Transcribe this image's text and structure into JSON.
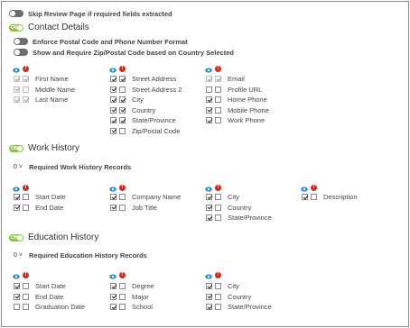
{
  "skip_review": {
    "label": "Skip Review Page if required fields extracted",
    "enabled": false
  },
  "contact": {
    "title": "Contact Details",
    "toggle_text": "ON",
    "options": [
      {
        "label": "Enforce Postal Code and Phone Number Format",
        "enabled": false
      },
      {
        "label": "Show and Require Zip/Postal Code based on Country Selected",
        "enabled": false
      }
    ],
    "columns": [
      {
        "fields": [
          {
            "label": "First Name",
            "visible": true,
            "required": true,
            "disabled": true
          },
          {
            "label": "Middle Name",
            "visible": true,
            "required": false,
            "disabled": true
          },
          {
            "label": "Last Name",
            "visible": true,
            "required": true,
            "disabled": true
          }
        ]
      },
      {
        "fields": [
          {
            "label": "Street Address",
            "visible": true,
            "required": true
          },
          {
            "label": "Street Address 2",
            "visible": true,
            "required": false
          },
          {
            "label": "City",
            "visible": true,
            "required": true
          },
          {
            "label": "Country",
            "visible": true,
            "required": true
          },
          {
            "label": "State/Province",
            "visible": true,
            "required": true
          },
          {
            "label": "Zip/Postal Code",
            "visible": true,
            "required": false
          }
        ]
      },
      {
        "fields": [
          {
            "label": "Email",
            "visible": true,
            "required": true,
            "disabled": true
          },
          {
            "label": "Profile URL",
            "visible": false,
            "required": false
          },
          {
            "label": "Home Phone",
            "visible": true,
            "required": false
          },
          {
            "label": "Mobile Phone",
            "visible": true,
            "required": false
          },
          {
            "label": "Work Phone",
            "visible": true,
            "required": false
          }
        ]
      }
    ]
  },
  "work": {
    "title": "Work History",
    "toggle_text": "ON",
    "count": "0",
    "count_label": "Required Work History Records",
    "columns": [
      {
        "fields": [
          {
            "label": "Start Date",
            "visible": true,
            "required": false
          },
          {
            "label": "End Date",
            "visible": true,
            "required": false
          }
        ]
      },
      {
        "fields": [
          {
            "label": "Company Name",
            "visible": true,
            "required": false
          },
          {
            "label": "Job Title",
            "visible": true,
            "required": false
          }
        ]
      },
      {
        "fields": [
          {
            "label": "City",
            "visible": true,
            "required": false
          },
          {
            "label": "Country",
            "visible": true,
            "required": false
          },
          {
            "label": "State/Province",
            "visible": true,
            "required": false
          }
        ]
      },
      {
        "fields": [
          {
            "label": "Description",
            "visible": true,
            "required": false
          }
        ]
      }
    ]
  },
  "education": {
    "title": "Education History",
    "toggle_text": "ON",
    "count": "0",
    "count_label": "Required Education History Records",
    "columns": [
      {
        "fields": [
          {
            "label": "Start Date",
            "visible": true,
            "required": false
          },
          {
            "label": "End Date",
            "visible": true,
            "required": false
          },
          {
            "label": "Graduation Date",
            "visible": false,
            "required": false
          }
        ]
      },
      {
        "fields": [
          {
            "label": "Degree",
            "visible": true,
            "required": false
          },
          {
            "label": "Major",
            "visible": true,
            "required": false
          },
          {
            "label": "School",
            "visible": true,
            "required": false
          }
        ]
      },
      {
        "fields": [
          {
            "label": "City",
            "visible": true,
            "required": false
          },
          {
            "label": "Country",
            "visible": true,
            "required": false
          },
          {
            "label": "State/Province",
            "visible": true,
            "required": false
          }
        ]
      }
    ]
  },
  "colors": {
    "toggle_on": "#8cc63f",
    "toggle_off": "#6e6e6e",
    "eye": "#2a8fd6",
    "required": "#d9261c"
  }
}
